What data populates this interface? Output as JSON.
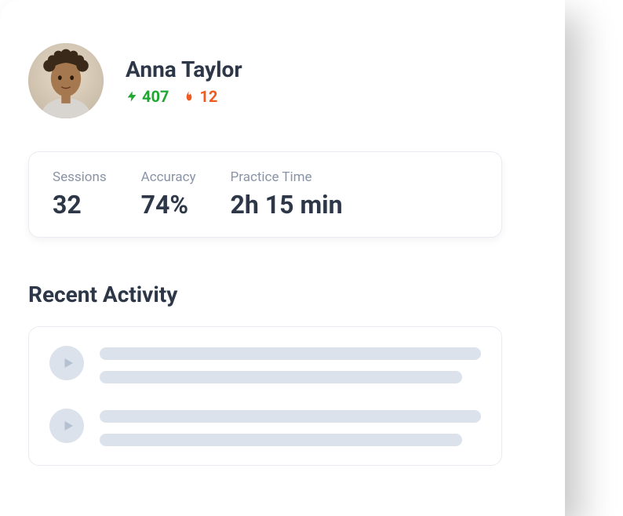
{
  "profile": {
    "name": "Anna Taylor",
    "points": "407",
    "streak": "12"
  },
  "metrics": {
    "sessions": {
      "label": "Sessions",
      "value": "32"
    },
    "accuracy": {
      "label": "Accuracy",
      "value": "74%"
    },
    "practice_time": {
      "label": "Practice Time",
      "value": "2h 15 min"
    }
  },
  "recent_activity": {
    "title": "Recent Activity"
  }
}
